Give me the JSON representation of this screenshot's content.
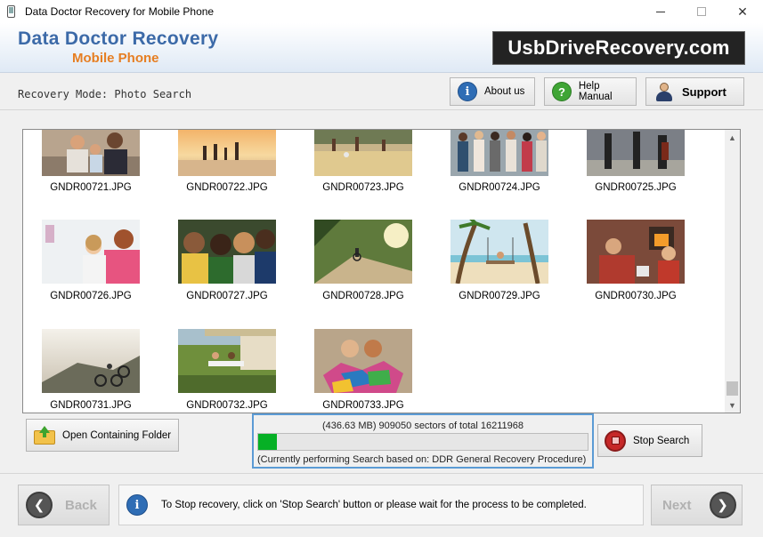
{
  "window": {
    "title": "Data Doctor Recovery for Mobile Phone",
    "close_glyph": "✕"
  },
  "banner": {
    "brand_line1": "Data Doctor Recovery",
    "brand_line2": "Mobile Phone",
    "site": "UsbDriveRecovery.com"
  },
  "mode": {
    "label": "Recovery Mode: Photo Search"
  },
  "toolbar": {
    "about_label": "About us",
    "help_label": "Help Manual",
    "support_label": "Support",
    "info_glyph": "i",
    "help_glyph": "?"
  },
  "files": [
    {
      "name": "GNDR00721.JPG"
    },
    {
      "name": "GNDR00722.JPG"
    },
    {
      "name": "GNDR00723.JPG"
    },
    {
      "name": "GNDR00724.JPG"
    },
    {
      "name": "GNDR00725.JPG"
    },
    {
      "name": "GNDR00726.JPG"
    },
    {
      "name": "GNDR00727.JPG"
    },
    {
      "name": "GNDR00728.JPG"
    },
    {
      "name": "GNDR00729.JPG"
    },
    {
      "name": "GNDR00730.JPG"
    },
    {
      "name": "GNDR00731.JPG"
    },
    {
      "name": "GNDR00732.JPG"
    },
    {
      "name": "GNDR00733.JPG"
    }
  ],
  "actions": {
    "open_folder_label": "Open Containing Folder",
    "stop_label": "Stop Search"
  },
  "progress": {
    "stats": "(436.63 MB) 909050   sectors  of  total  16211968",
    "fraction": 0.056,
    "procedure": "(Currently performing Search based on:  DDR General Recovery Procedure)"
  },
  "nav": {
    "back_label": "Back",
    "next_label": "Next",
    "back_glyph": "❮",
    "next_glyph": "❯",
    "status_message": "To Stop recovery, click on 'Stop Search' button or please wait for the process to be completed."
  },
  "colors": {
    "accent_blue": "#3c6aa8",
    "accent_orange": "#e67e22",
    "progress_green": "#06b025",
    "focus_border": "#5b9bd5"
  }
}
